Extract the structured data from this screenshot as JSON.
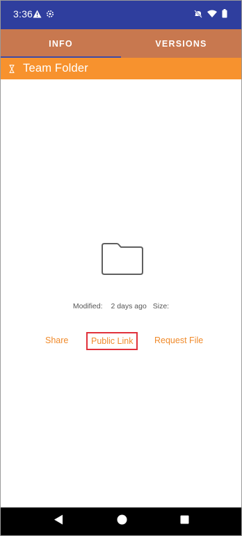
{
  "status_bar": {
    "time": "3:36",
    "icons": [
      "alert-triangle-icon",
      "settings-gear-icon",
      "mute-icon",
      "wifi-icon",
      "battery-icon"
    ]
  },
  "tabs": [
    {
      "label": "INFO",
      "active": true
    },
    {
      "label": "VERSIONS",
      "active": false
    }
  ],
  "folder": {
    "title": "Team Folder",
    "icon": "hourglass-icon"
  },
  "details": {
    "modified_label": "Modified:",
    "modified_value": "2 days ago",
    "size_label": "Size:"
  },
  "actions": {
    "share": "Share",
    "public_link": "Public Link",
    "request_file": "Request File"
  },
  "colors": {
    "status_bar": "#2f3e9e",
    "tab_bar": "#c8784f",
    "folder_header": "#f7922e",
    "action_text": "#f08a2a",
    "highlight_border": "#e0303a"
  },
  "nav": [
    "back-icon",
    "home-icon",
    "recents-icon"
  ]
}
